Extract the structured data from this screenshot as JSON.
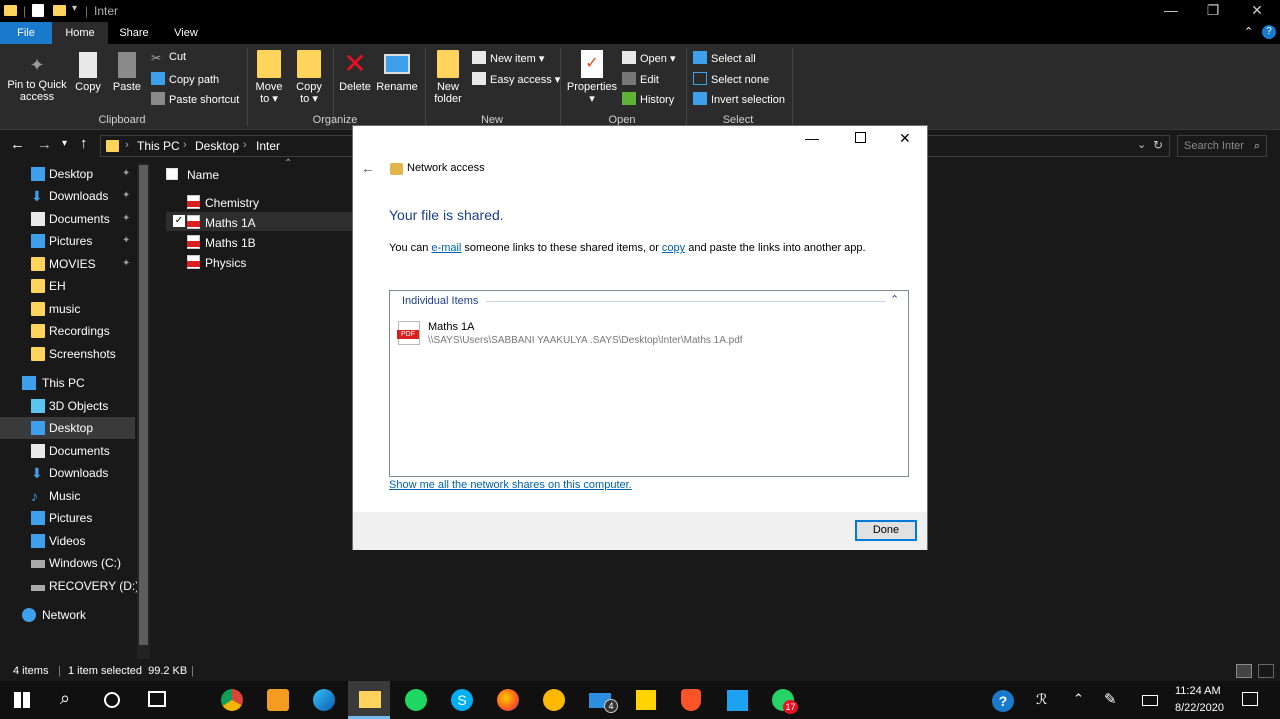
{
  "window": {
    "title": "Inter"
  },
  "tabs": {
    "file": "File",
    "home": "Home",
    "share": "Share",
    "view": "View"
  },
  "ribbon": {
    "clipboard": {
      "pin": "Pin to Quick",
      "pin2": "access",
      "copy": "Copy",
      "paste": "Paste",
      "cut": "Cut",
      "copy_path": "Copy path",
      "paste_shortcut": "Paste shortcut",
      "label": "Clipboard"
    },
    "organize": {
      "move": "Move",
      "move2": "to ▾",
      "copyto": "Copy",
      "copyto2": "to ▾",
      "delete": "Delete",
      "rename": "Rename",
      "label": "Organize"
    },
    "new": {
      "folder": "New",
      "folder2": "folder",
      "new_item": "New item ▾",
      "easy_access": "Easy access ▾",
      "label": "New"
    },
    "open": {
      "properties": "Properties",
      "open": "Open ▾",
      "edit": "Edit",
      "history": "History",
      "label": "Open"
    },
    "select": {
      "all": "Select all",
      "none": "Select none",
      "invert": "Invert selection",
      "label": "Select"
    }
  },
  "address": {
    "crumbs": [
      "This PC",
      "Desktop",
      "Inter"
    ],
    "search_placeholder": "Search Inter"
  },
  "sidebar": {
    "quick": [
      {
        "label": "Desktop",
        "icon": "desktop-icon"
      },
      {
        "label": "Downloads",
        "icon": "download-icon"
      },
      {
        "label": "Documents",
        "icon": "documents-icon"
      },
      {
        "label": "Pictures",
        "icon": "pictures-icon"
      },
      {
        "label": "MOVIES",
        "icon": "folder-icon"
      },
      {
        "label": "EH",
        "icon": "folder-icon"
      },
      {
        "label": "music",
        "icon": "folder-icon"
      },
      {
        "label": "Recordings",
        "icon": "folder-icon"
      },
      {
        "label": "Screenshots",
        "icon": "folder-icon"
      }
    ],
    "thispc": "This PC",
    "pc": [
      {
        "label": "3D Objects"
      },
      {
        "label": "Desktop"
      },
      {
        "label": "Documents"
      },
      {
        "label": "Downloads"
      },
      {
        "label": "Music"
      },
      {
        "label": "Pictures"
      },
      {
        "label": "Videos"
      },
      {
        "label": "Windows (C:)"
      },
      {
        "label": "RECOVERY (D:)"
      }
    ],
    "network": "Network"
  },
  "files": {
    "column": "Name",
    "items": [
      "Chemistry",
      "Maths 1A",
      "Maths 1B",
      "Physics"
    ]
  },
  "dialog": {
    "title": "Network access",
    "heading": "Your file is shared.",
    "body_pre": "You can ",
    "email": "e-mail",
    "body_mid": " someone links to these shared items, or ",
    "copy": "copy",
    "body_post": " and paste the links into another app.",
    "group": "Individual Items",
    "item_name": "Maths 1A",
    "item_path": "\\\\SAYS\\Users\\SABBANI YAAKULYA .SAYS\\Desktop\\Inter\\Maths 1A.pdf",
    "show_all": "Show me all the network shares on this computer.",
    "done": "Done"
  },
  "status": {
    "count": "4 items",
    "selected": "1 item selected  99.2 KB"
  },
  "taskbar": {
    "time": "11:24 AM",
    "date": "8/22/2020",
    "mail_badge": "4",
    "whatsapp_badge": "17"
  }
}
